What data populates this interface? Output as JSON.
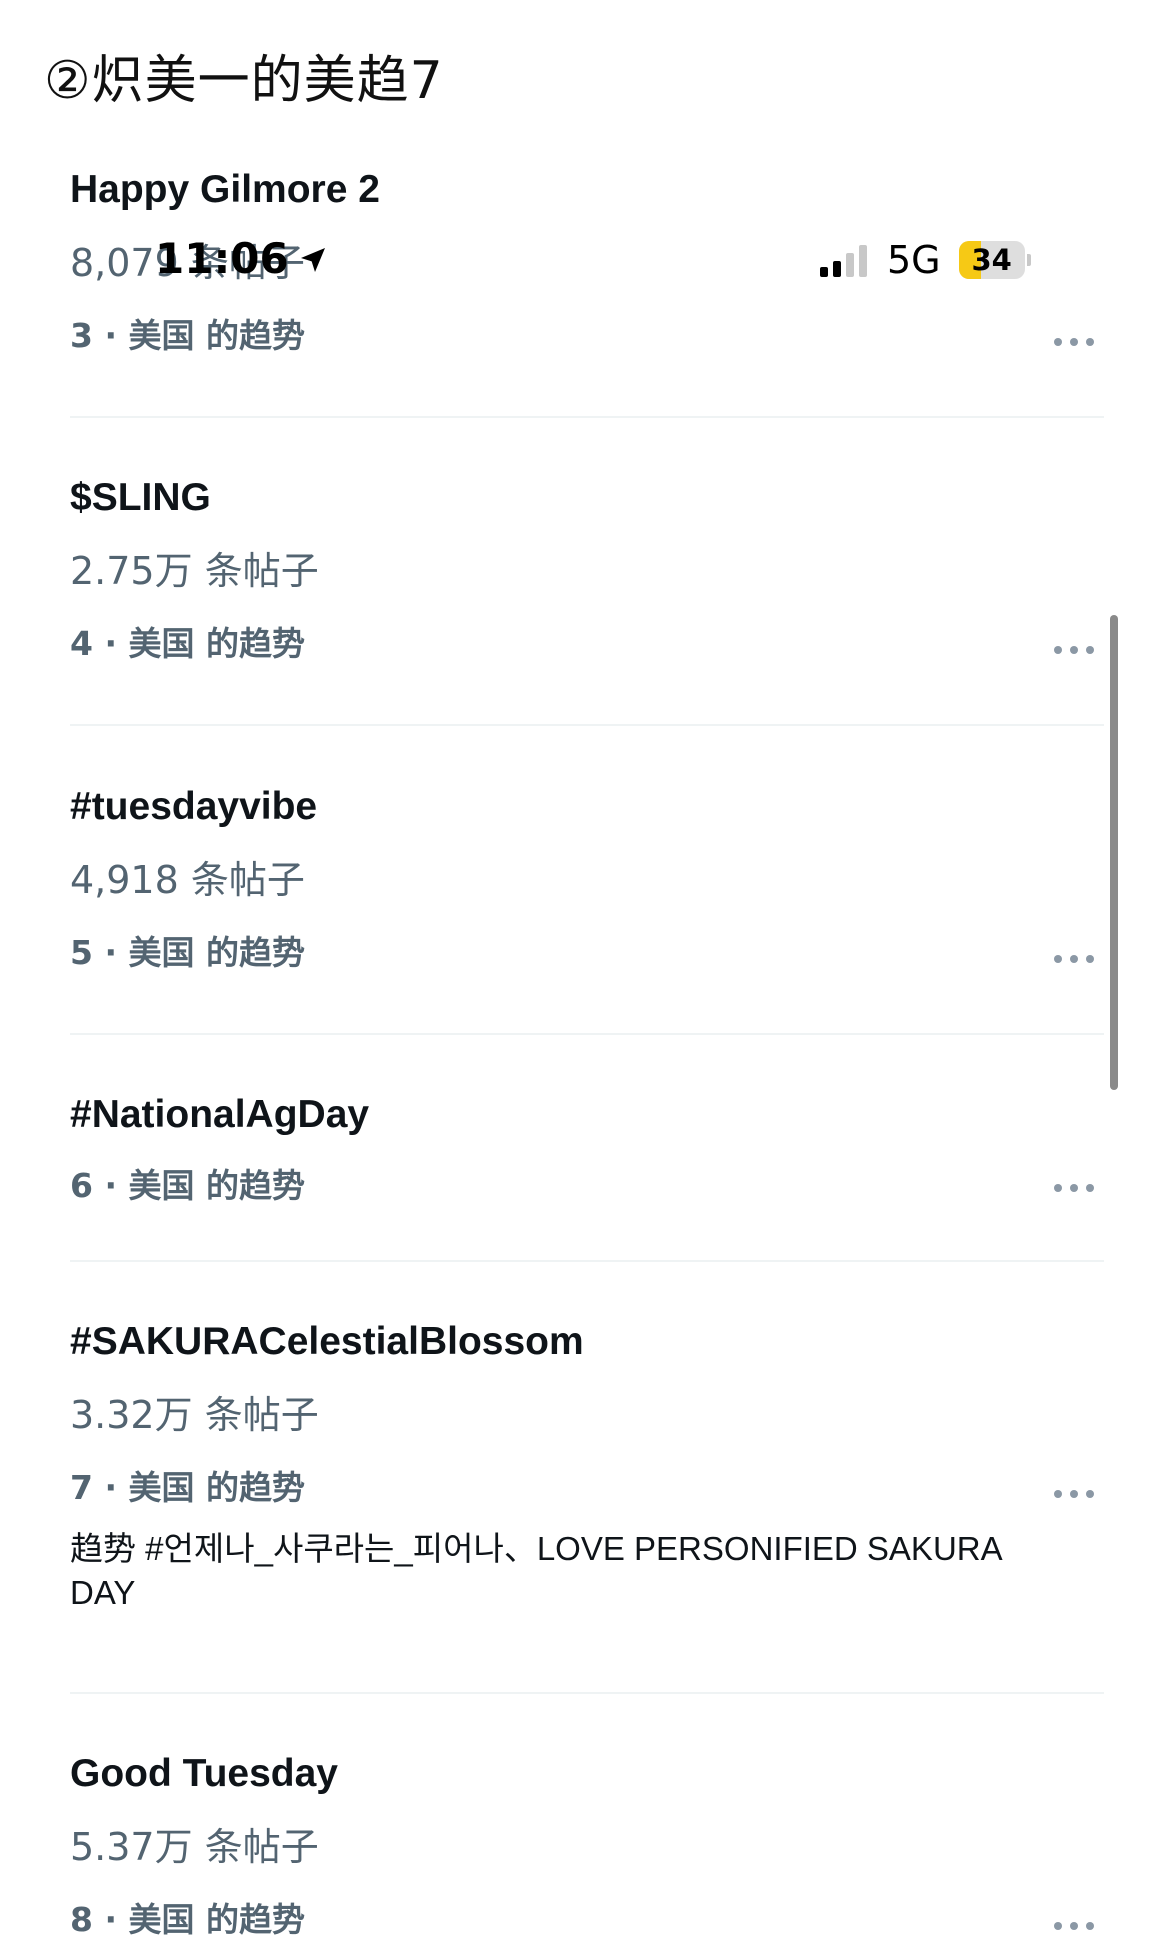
{
  "caption": "②炽美一的美趋7",
  "status_bar": {
    "time": "11:06",
    "network": "5G",
    "battery": "34",
    "battery_level_percent": 34,
    "signal_bars_active": 2,
    "signal_bars_total": 4
  },
  "trends": [
    {
      "title": "Happy Gilmore 2",
      "count": "8,079 条帖子",
      "meta": "3 · 美国 的趋势"
    },
    {
      "title": "$SLING",
      "count": "2.75万 条帖子",
      "meta": "4 · 美国 的趋势"
    },
    {
      "title": "#tuesdayvibe",
      "count": "4,918 条帖子",
      "meta": "5 · 美国 的趋势"
    },
    {
      "title": "#NationalAgDay",
      "meta": "6 · 美国 的趋势"
    },
    {
      "title": "#SAKURACelestialBlossom",
      "count": "3.32万 条帖子",
      "meta": "7 · 美国 的趋势",
      "extra": "趋势 #언제나_사쿠라는_피어나、LOVE PERSONIFIED SAKURA DAY"
    },
    {
      "title": "Good Tuesday",
      "count": "5.37万 条帖子",
      "meta": "8 · 美国 的趋势"
    }
  ]
}
